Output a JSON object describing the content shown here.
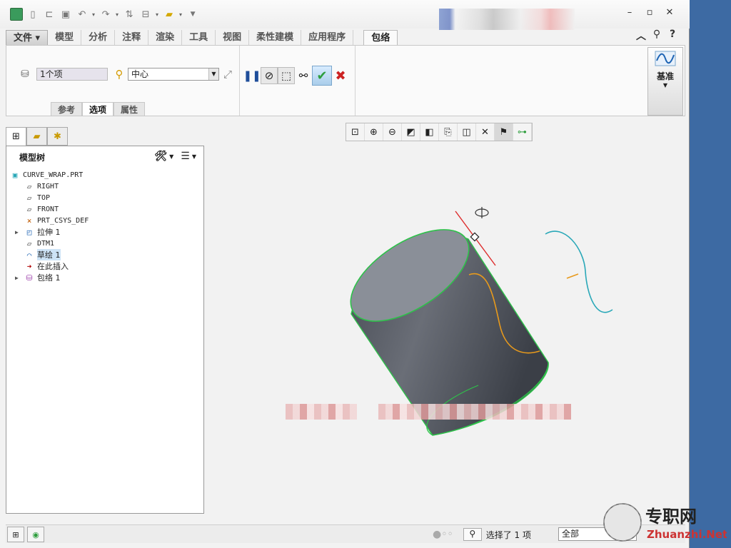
{
  "quick_access": {
    "icons": [
      "app-logo-icon",
      "new-icon",
      "open-icon",
      "save-icon",
      "undo-icon",
      "redo-icon",
      "regenerate-icon",
      "windows-icon",
      "folder-icon",
      "customize-icon"
    ]
  },
  "window_controls": {
    "minimize": "–",
    "restore": "▫",
    "close": "✕"
  },
  "ribbon_tabs": [
    {
      "label": "文件 ▾",
      "kind": "file"
    },
    {
      "label": "模型"
    },
    {
      "label": "分析"
    },
    {
      "label": "注释"
    },
    {
      "label": "渲染"
    },
    {
      "label": "工具"
    },
    {
      "label": "视图"
    },
    {
      "label": "柔性建模"
    },
    {
      "label": "应用程序"
    },
    {
      "label": "包络",
      "active": true
    }
  ],
  "wrap_dashboard": {
    "sketch_field": "1个项",
    "anchor_select": "中心",
    "subtabs": [
      "参考",
      "选项",
      "属性"
    ],
    "active_subtab": "选项",
    "datum_label": "基准"
  },
  "model_tree": {
    "title": "模型树",
    "items": [
      {
        "label": "CURVE_WRAP.PRT",
        "icon": "part-icon",
        "level": 0
      },
      {
        "label": "RIGHT",
        "icon": "datum-plane-icon",
        "level": 1
      },
      {
        "label": "TOP",
        "icon": "datum-plane-icon",
        "level": 1
      },
      {
        "label": "FRONT",
        "icon": "datum-plane-icon",
        "level": 1
      },
      {
        "label": "PRT_CSYS_DEF",
        "icon": "csys-icon",
        "level": 1
      },
      {
        "label": "拉伸 1",
        "icon": "extrude-icon",
        "level": 1,
        "expandable": true
      },
      {
        "label": "DTM1",
        "icon": "datum-plane-icon",
        "level": 1
      },
      {
        "label": "草绘 1",
        "icon": "sketch-icon",
        "level": 1,
        "selected": true
      },
      {
        "label": "在此插入",
        "icon": "insert-arrow-icon",
        "level": 1
      },
      {
        "label": "包络 1",
        "icon": "wrap-icon",
        "level": 1,
        "expandable": true
      }
    ]
  },
  "graphics_toolbar": [
    "refit-icon",
    "zoom-in-icon",
    "zoom-out-icon",
    "repaint-icon",
    "display-style-icon",
    "saved-views-icon",
    "view-manager-icon",
    "datum-display-icon",
    "annotation-display-icon",
    "spin-center-icon"
  ],
  "status_bar": {
    "message": "选择了 1 项",
    "filter": "全部"
  },
  "watermark": {
    "brand": "专职网",
    "url": "Zhuanzhi.Net"
  },
  "colors": {
    "desktop": "#3d6aa3",
    "cylinder": "#5a5f68",
    "edge": "#2ec24a",
    "wrap_curve": "#e89a1c",
    "sketch_curve": "#2aa8b8",
    "accept": "#2e9e3e",
    "cancel": "#cc2222"
  }
}
